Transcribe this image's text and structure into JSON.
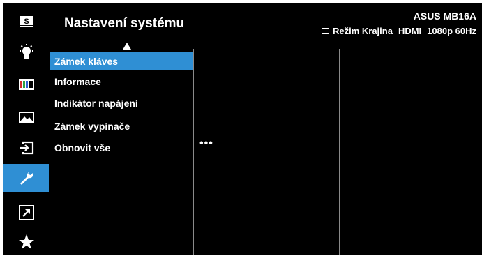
{
  "header": {
    "title": "Nastavení systému",
    "model": "ASUS MB16A",
    "mode": "Režim Krajina",
    "input": "HDMI",
    "resolution": "1080p 60Hz"
  },
  "sidebar": {
    "items": [
      {
        "icon": "splendid-s-icon"
      },
      {
        "icon": "blue-light-filter-icon"
      },
      {
        "icon": "color-bars-icon"
      },
      {
        "icon": "image-icon"
      },
      {
        "icon": "input-select-icon"
      },
      {
        "icon": "wrench-icon",
        "active": true
      },
      {
        "icon": "shortcut-arrow-icon"
      },
      {
        "icon": "star-icon"
      }
    ]
  },
  "menu": {
    "items": [
      {
        "label": "Zámek kláves",
        "selected": true
      },
      {
        "label": "Informace"
      },
      {
        "label": "Indikátor napájení"
      },
      {
        "label": "Zámek vypínače"
      },
      {
        "label": "Obnovit vše"
      }
    ]
  },
  "submenu": {
    "more": "•••"
  },
  "colors": {
    "background": "#000000",
    "accent": "#2f8fd4",
    "text": "#ffffff",
    "divider": "#8a8a8a"
  }
}
